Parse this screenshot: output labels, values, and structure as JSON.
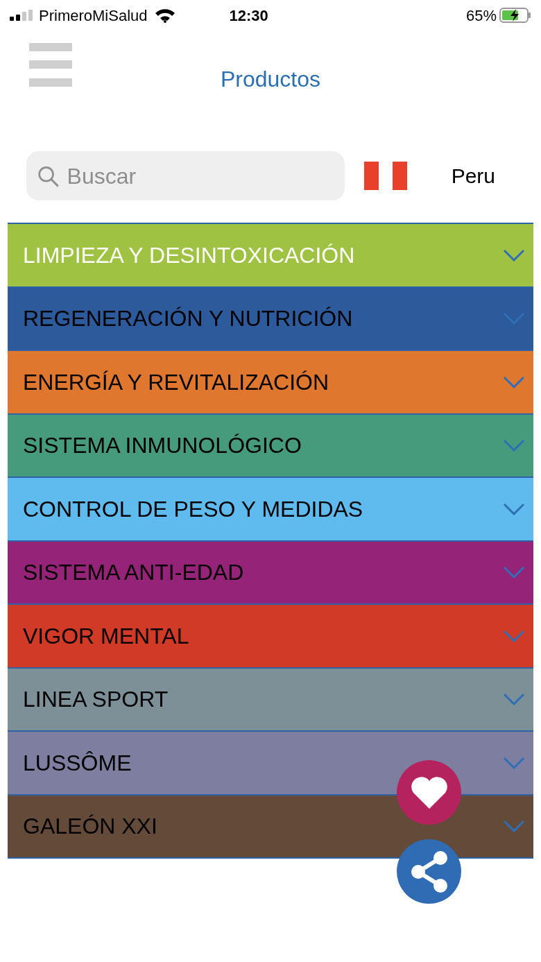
{
  "status_bar": {
    "carrier": "PrimeroMiSalud",
    "time": "12:30",
    "battery": "65%"
  },
  "header": {
    "title": "Productos"
  },
  "search": {
    "placeholder": "Buscar"
  },
  "country": {
    "name": "Peru"
  },
  "categories": [
    {
      "label": "LIMPIEZA Y DESINTOXICACIÓN",
      "color": "#9fc243",
      "inverted": true
    },
    {
      "label": "REGENERACIÓN Y NUTRICIÓN",
      "color": "#2d5a9a",
      "inverted": false
    },
    {
      "label": "ENERGÍA Y REVITALIZACIÓN",
      "color": "#df772e",
      "inverted": false
    },
    {
      "label": "SISTEMA INMUNOLÓGICO",
      "color": "#459b7b",
      "inverted": false
    },
    {
      "label": "CONTROL DE PESO Y MEDIDAS",
      "color": "#5fbbed",
      "inverted": false
    },
    {
      "label": "SISTEMA ANTI-EDAD",
      "color": "#952378",
      "inverted": false
    },
    {
      "label": "VIGOR MENTAL",
      "color": "#d23a28",
      "inverted": false
    },
    {
      "label": "LINEA SPORT",
      "color": "#7d8f97",
      "inverted": false
    },
    {
      "label": "LUSSÔME",
      "color": "#7e7fa0",
      "inverted": false
    },
    {
      "label": "GALEÓN XXI",
      "color": "#644a39",
      "inverted": false
    }
  ]
}
